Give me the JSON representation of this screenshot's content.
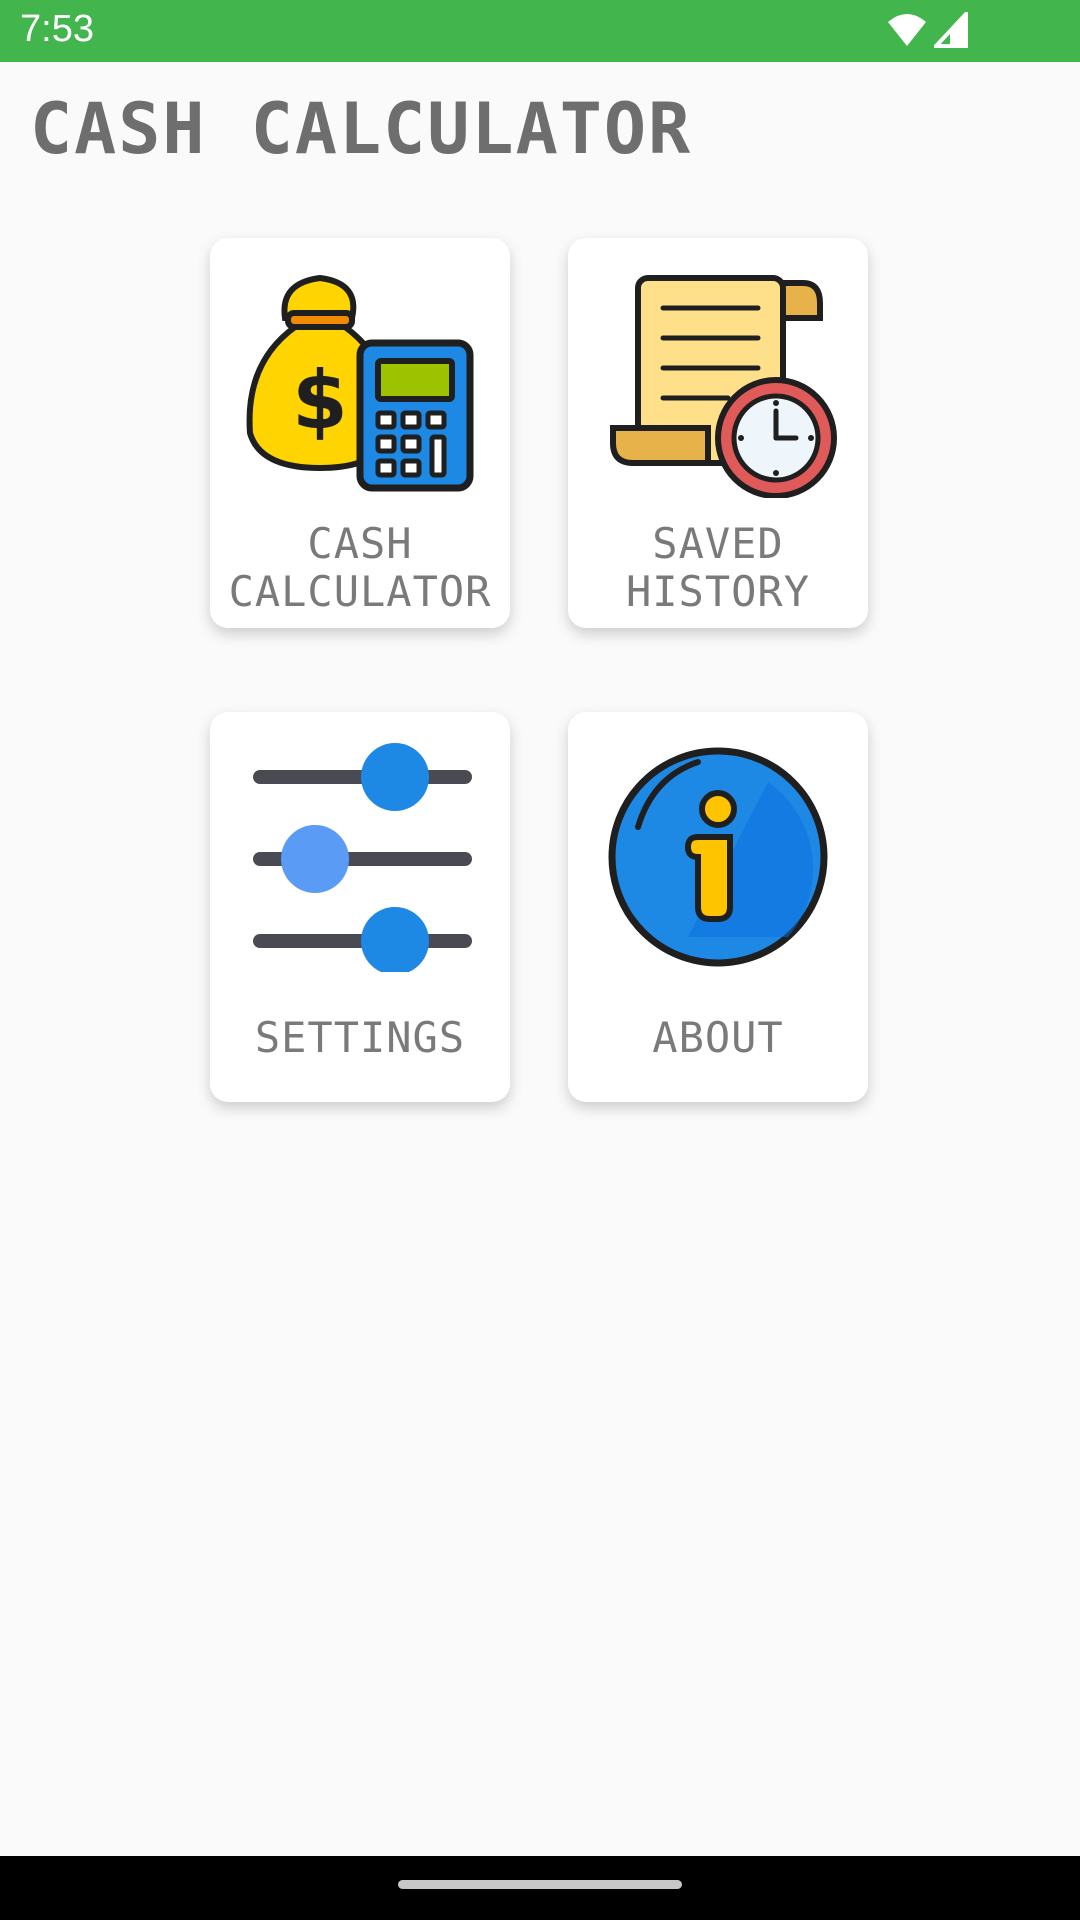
{
  "status_bar": {
    "time": "7:53",
    "icons": [
      "wifi-icon",
      "signal-icon"
    ]
  },
  "header": {
    "title": "CASH CALCULATOR"
  },
  "menu": {
    "cash_calculator": {
      "line1": "CASH",
      "line2": "CALCULATOR",
      "icon": "money-bag-calculator-icon"
    },
    "saved_history": {
      "line1": "SAVED",
      "line2": "HISTORY",
      "icon": "receipt-clock-icon"
    },
    "settings": {
      "line1": "SETTINGS",
      "icon": "sliders-icon"
    },
    "about": {
      "line1": "ABOUT",
      "icon": "info-icon"
    }
  },
  "colors": {
    "status_bar": "#43b54d",
    "background": "#fafafa",
    "card": "#ffffff",
    "label_text": "#7a7a7a",
    "accent_blue": "#1e88e5"
  }
}
